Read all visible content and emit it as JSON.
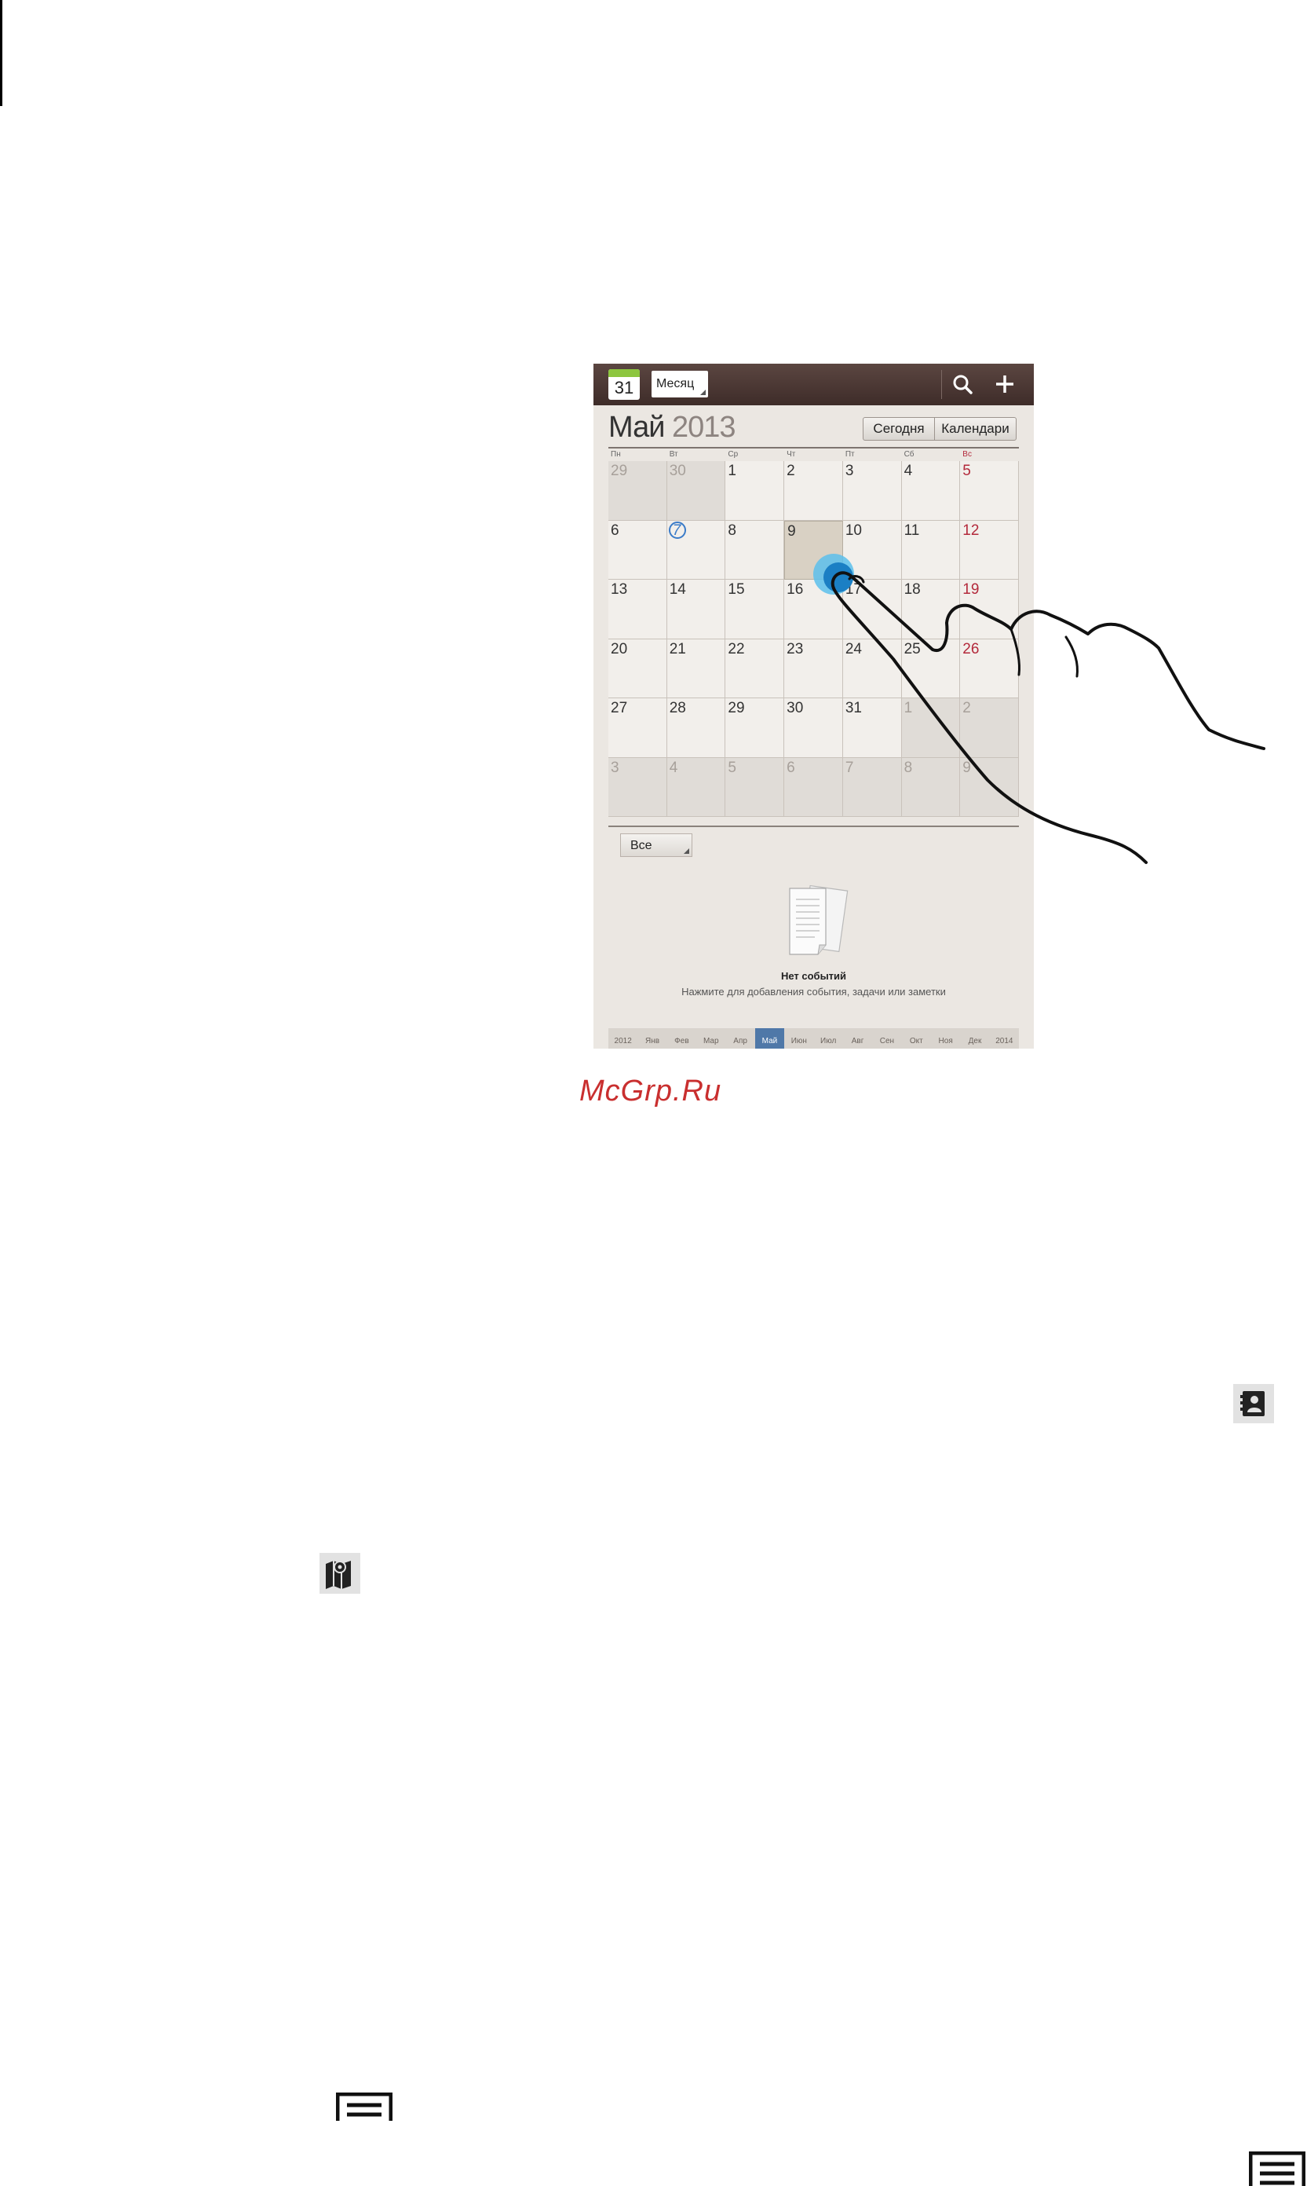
{
  "calendar": {
    "app_icon_day": "31",
    "view_mode": "Месяц",
    "month": "Май",
    "year": "2013",
    "today_button": "Сегодня",
    "calendars_button": "Календари",
    "weekdays": [
      "Пн",
      "Вт",
      "Ср",
      "Чт",
      "Пт",
      "Сб",
      "Вс"
    ],
    "weeks": [
      [
        {
          "d": "29",
          "other": true
        },
        {
          "d": "30",
          "other": true
        },
        {
          "d": "1"
        },
        {
          "d": "2"
        },
        {
          "d": "3"
        },
        {
          "d": "4"
        },
        {
          "d": "5"
        }
      ],
      [
        {
          "d": "6"
        },
        {
          "d": "7",
          "today": true
        },
        {
          "d": "8"
        },
        {
          "d": "9",
          "selected": true
        },
        {
          "d": "10"
        },
        {
          "d": "11"
        },
        {
          "d": "12"
        }
      ],
      [
        {
          "d": "13"
        },
        {
          "d": "14"
        },
        {
          "d": "15"
        },
        {
          "d": "16"
        },
        {
          "d": "17"
        },
        {
          "d": "18"
        },
        {
          "d": "19"
        }
      ],
      [
        {
          "d": "20"
        },
        {
          "d": "21"
        },
        {
          "d": "22"
        },
        {
          "d": "23"
        },
        {
          "d": "24"
        },
        {
          "d": "25"
        },
        {
          "d": "26"
        }
      ],
      [
        {
          "d": "27"
        },
        {
          "d": "28"
        },
        {
          "d": "29"
        },
        {
          "d": "30"
        },
        {
          "d": "31"
        },
        {
          "d": "1",
          "other": true
        },
        {
          "d": "2",
          "other": true
        }
      ],
      [
        {
          "d": "3",
          "other": true
        },
        {
          "d": "4",
          "other": true
        },
        {
          "d": "5",
          "other": true
        },
        {
          "d": "6",
          "other": true
        },
        {
          "d": "7",
          "other": true
        },
        {
          "d": "8",
          "other": true
        },
        {
          "d": "9",
          "other": true
        }
      ]
    ],
    "filter": "Все",
    "no_events_title": "Нет событий",
    "no_events_hint": "Нажмите для добавления события, задачи или заметки",
    "month_strip": [
      "2012",
      "Янв",
      "Фев",
      "Мар",
      "Апр",
      "Май",
      "Июн",
      "Июл",
      "Авг",
      "Сен",
      "Окт",
      "Ноя",
      "Дек",
      "2014"
    ],
    "active_month": "Май"
  },
  "watermark": "McGrp.Ru",
  "icons": {
    "search": "search-icon",
    "add": "add-icon",
    "contacts": "contacts-icon",
    "maps": "maps-icon",
    "menu": "menu-icon"
  },
  "colors": {
    "actionbar": "#4a3733",
    "selected_day": "#d9d1c4",
    "sunday": "#b3293b",
    "today_ring": "#3a7bc8",
    "active_month": "#4f78a8",
    "watermark": "#c92f2f"
  }
}
